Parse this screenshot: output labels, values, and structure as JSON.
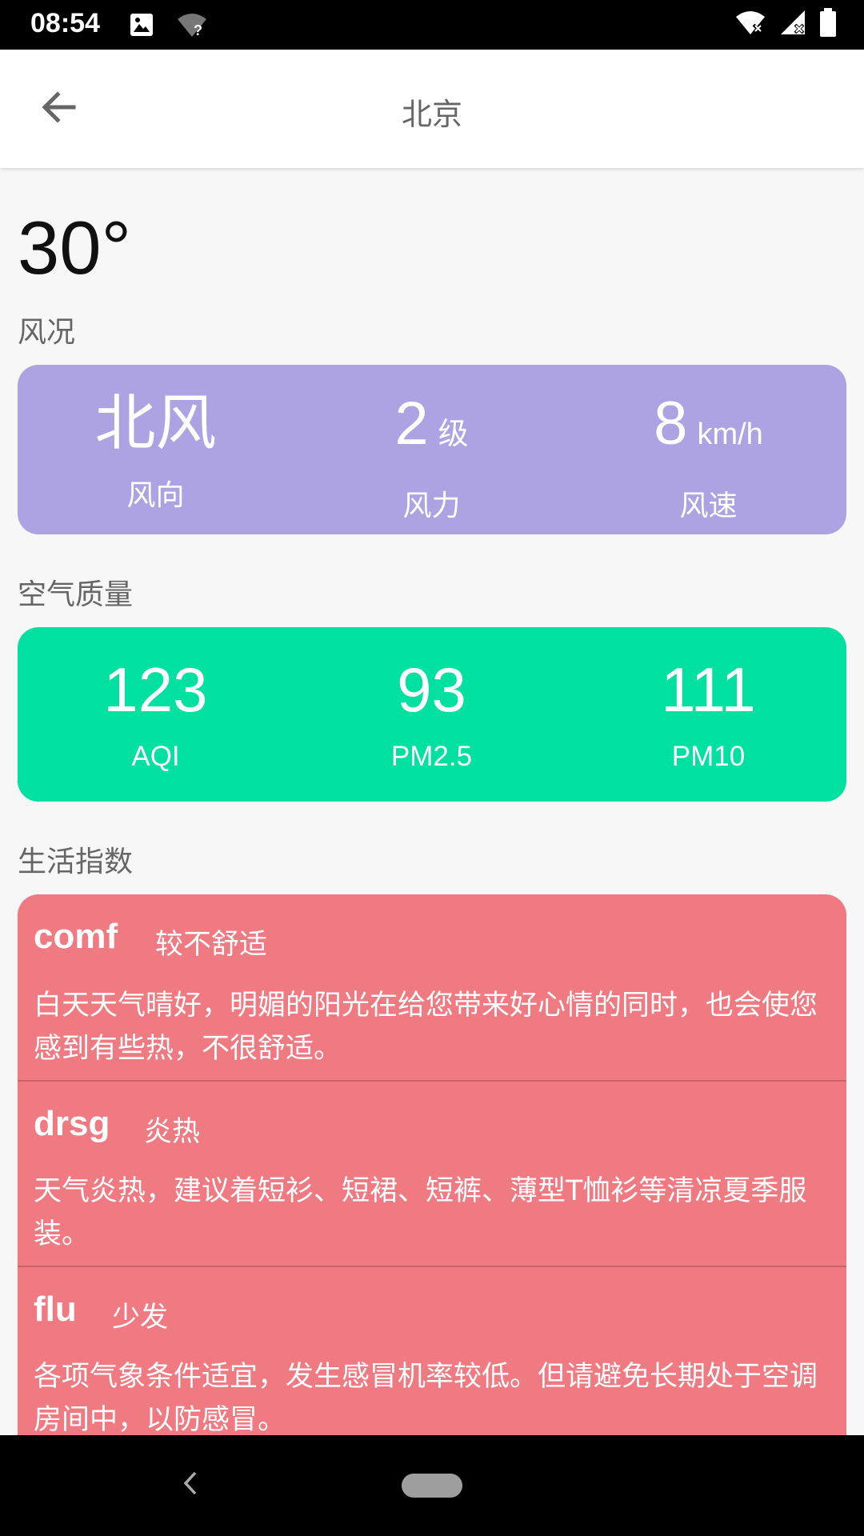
{
  "status_bar": {
    "time": "08:54",
    "icons_left": [
      "image-icon",
      "wifi-question-icon"
    ],
    "icons_right": [
      "wifi-off-icon",
      "signal-off-icon",
      "battery-icon"
    ]
  },
  "app_bar": {
    "title": "北京",
    "back_icon": "arrow-left-icon"
  },
  "weather": {
    "temperature": "30°"
  },
  "wind": {
    "section_label": "风况",
    "direction_value": "北风",
    "direction_label": "风向",
    "force_value": "2",
    "force_unit": "级",
    "force_label": "风力",
    "speed_value": "8",
    "speed_unit": "km/h",
    "speed_label": "风速",
    "card_color": "#ada3e2"
  },
  "air_quality": {
    "section_label": "空气质量",
    "aqi_value": "123",
    "aqi_label": "AQI",
    "pm25_value": "93",
    "pm25_label": "PM2.5",
    "pm10_value": "111",
    "pm10_label": "PM10",
    "card_color": "#00e0a1"
  },
  "life_index": {
    "section_label": "生活指数",
    "card_color": "#ef7a81",
    "items": [
      {
        "key": "comf",
        "level": "较不舒适",
        "text": "白天天气晴好，明媚的阳光在给您带来好心情的同时，也会使您感到有些热，不很舒适。"
      },
      {
        "key": "drsg",
        "level": "炎热",
        "text": "天气炎热，建议着短衫、短裙、短裤、薄型T恤衫等清凉夏季服装。"
      },
      {
        "key": "flu",
        "level": "少发",
        "text": "各项气象条件适宜，发生感冒机率较低。但请避免长期处于空调房间中，以防感冒。"
      }
    ]
  },
  "nav_bar": {
    "back_icon": "nav-back-icon",
    "home_icon": "home-pill-icon"
  }
}
